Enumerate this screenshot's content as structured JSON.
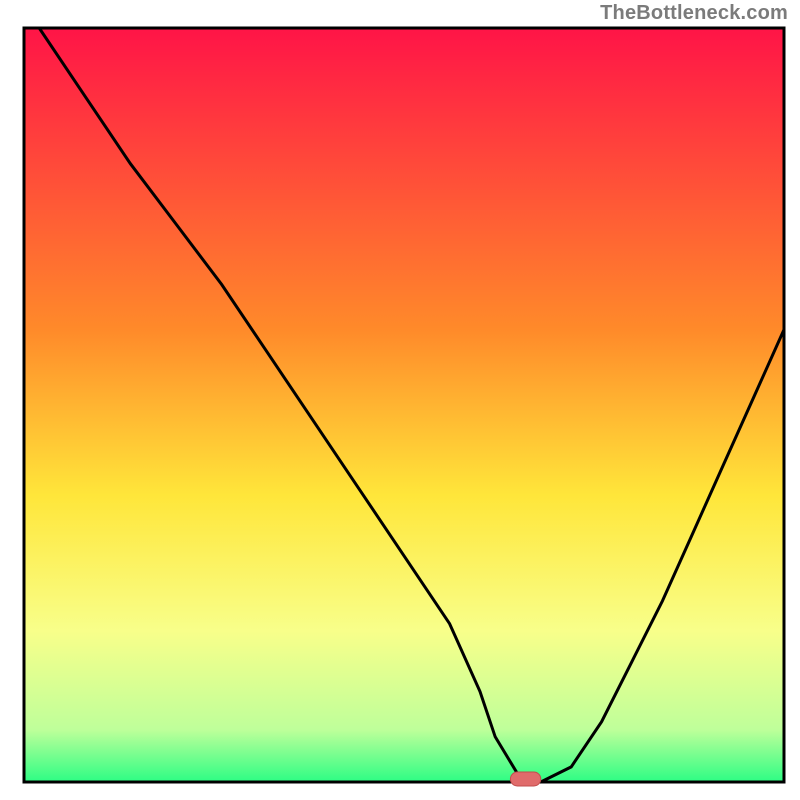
{
  "attribution": "TheBottleneck.com",
  "colors": {
    "frame": "#000000",
    "curve": "#000000",
    "marker_fill": "#e06b6b",
    "marker_stroke": "#c24c4c",
    "grad_top": "#ff1447",
    "grad_mid1": "#ff8a2a",
    "grad_mid2": "#ffe63a",
    "grad_low1": "#f8ff8a",
    "grad_low2": "#bfff9a",
    "grad_bottom": "#2dfd84"
  },
  "chart_data": {
    "type": "line",
    "title": "",
    "xlabel": "",
    "ylabel": "",
    "xlim": [
      0,
      100
    ],
    "ylim": [
      0,
      100
    ],
    "x": [
      2,
      8,
      14,
      20,
      26,
      32,
      38,
      44,
      50,
      56,
      60,
      62,
      65,
      68,
      72,
      76,
      80,
      84,
      88,
      92,
      96,
      100
    ],
    "values": [
      100,
      91,
      82,
      74,
      66,
      57,
      48,
      39,
      30,
      21,
      12,
      6,
      1,
      0,
      2,
      8,
      16,
      24,
      33,
      42,
      51,
      60
    ],
    "min_marker": {
      "x": 66,
      "y": 0,
      "w": 4,
      "h": 2
    },
    "notes": "V-shaped bottleneck curve; minimum around x≈66 where bottleneck ≈0. Values approximate, read from vertical extent of plot area."
  }
}
